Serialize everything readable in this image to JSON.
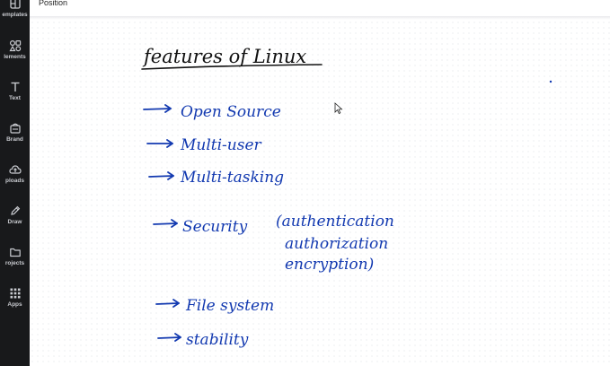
{
  "topbar": {
    "position_label": "Position"
  },
  "sidebar": {
    "items": [
      {
        "label": "emplates",
        "icon": "templates-icon"
      },
      {
        "label": "lements",
        "icon": "elements-icon"
      },
      {
        "label": "Text",
        "icon": "text-icon"
      },
      {
        "label": "Brand",
        "icon": "brand-icon"
      },
      {
        "label": "ploads",
        "icon": "uploads-icon"
      },
      {
        "label": "Draw",
        "icon": "draw-icon"
      },
      {
        "label": "rojects",
        "icon": "projects-icon"
      },
      {
        "label": "Apps",
        "icon": "apps-icon"
      }
    ]
  },
  "canvas": {
    "title": "features of Linux",
    "items": [
      "Open Source",
      "Multi-user",
      "Multi-tasking",
      "Security",
      "File system",
      "stability"
    ],
    "security_note": {
      "line1": "(authentication",
      "line2": "authorization",
      "line3": "encryption)"
    }
  },
  "colors": {
    "sidebar_bg": "#18191b",
    "ink_blue": "#1239b0",
    "ink_black": "#111111"
  }
}
